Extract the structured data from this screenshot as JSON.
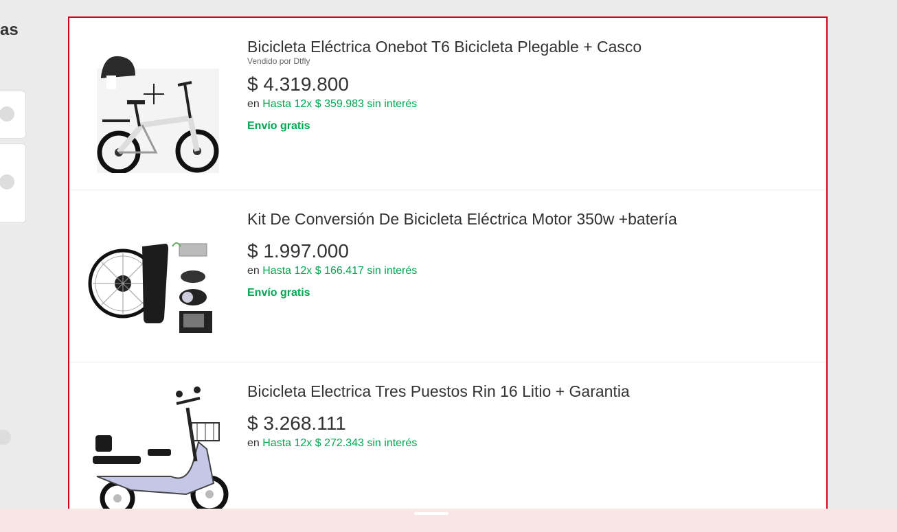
{
  "sidebar": {
    "heading_fragment": "as"
  },
  "results": [
    {
      "title": "Bicicleta Eléctrica Onebot T6 Bicicleta Plegable + Casco",
      "seller": "Vendido por Dtfly",
      "price": "$ 4.319.800",
      "installments_prefix": "en",
      "installments": "Hasta 12x $ 359.983 sin interés",
      "shipping": "Envío gratis",
      "image_icon": "folding-ebike-with-helmet"
    },
    {
      "title": "Kit De Conversión De Bicicleta Eléctrica Motor 350w +batería",
      "price": "$ 1.997.000",
      "installments_prefix": "en",
      "installments": "Hasta 12x $ 166.417 sin interés",
      "shipping": "Envío gratis",
      "image_icon": "ebike-conversion-kit"
    },
    {
      "title": "Bicicleta Electrica Tres Puestos Rin 16 Litio + Garantia",
      "price": "$ 3.268.111",
      "installments_prefix": "en",
      "installments": "Hasta 12x $ 272.343 sin interés",
      "image_icon": "three-seat-electric-scooter"
    }
  ],
  "colors": {
    "highlight_border": "#d0021b",
    "accent_green": "#00a650",
    "page_bg": "#ebebeb"
  }
}
